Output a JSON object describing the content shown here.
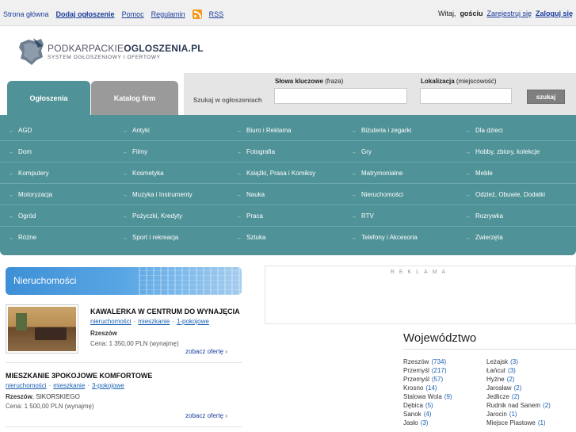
{
  "topbar": {
    "links": [
      "Strona główna",
      "Dodaj ogłoszenie",
      "Pomoc",
      "Regulamin",
      "RSS"
    ],
    "greeting": "Witaj,",
    "user": "gościu",
    "register": "Zarejestruj się",
    "login": "Zaloguj się"
  },
  "logo": {
    "name_part1": "PODKARPACKIE",
    "name_part2": "OGLOSZENIA.PL",
    "subtitle": "SYSTEM OGŁOSZENIOWY I OFERTOWY"
  },
  "tabs": {
    "ads": "Ogłoszenia",
    "catalog": "Katalog firm"
  },
  "search": {
    "label": "Szukaj w ogłoszeniach",
    "keywords_label": "Słowa kluczowe",
    "keywords_hint": "(fraza)",
    "location_label": "Lokalizacja",
    "location_hint": "(miejscowość)",
    "keywords_value": "",
    "location_value": "",
    "button": "szukaj"
  },
  "categories": [
    [
      "AGD",
      "Antyki",
      "Biuro i Reklama",
      "Biżuteria i zegarki",
      "Dla dzieci"
    ],
    [
      "Dom",
      "Filmy",
      "Fotografia",
      "Gry",
      "Hobby, zbiory, kolekcje"
    ],
    [
      "Komputery",
      "Kosmetyka",
      "Książki, Prasa i Komiksy",
      "Matrymonialne",
      "Meble"
    ],
    [
      "Motoryzacja",
      "Muzyka i Instrumenty",
      "Nauka",
      "Nieruchomości",
      "Odzież, Obuwie, Dodatki"
    ],
    [
      "Ogród",
      "Pożyczki, Kredyty",
      "Praca",
      "RTV",
      "Rozrywka"
    ],
    [
      "Różne",
      "Sport i rekreacja",
      "Sztuka",
      "Telefony i Akcesoria",
      "Zwierzęta"
    ]
  ],
  "section": {
    "title": "Nieruchomości"
  },
  "ads": [
    {
      "title": "KAWALERKA W CENTRUM DO WYNAJĘCIA",
      "tags": [
        "nieruchomości",
        "mieszkanie",
        "1-pokojowe"
      ],
      "city": "Rzeszów",
      "street": "",
      "price": "Cena: 1 350,00 PLN (wynajmę)",
      "more": "zobacz ofertę ›"
    },
    {
      "title": "MIESZKANIE 3POKOJOWE KOMFORTOWE",
      "tags": [
        "nieruchomości",
        "mieszkanie",
        "3-pokojowe"
      ],
      "city": "Rzeszów",
      "street": ", SIKORSKIEGO",
      "price": "Cena: 1 500,00 PLN (wynajmę)",
      "more": "zobacz ofertę ›"
    }
  ],
  "reklama": "REKLAMA",
  "wojewodztwo": {
    "title": "Województwo",
    "left": [
      {
        "name": "Rzeszów",
        "count": "(734)"
      },
      {
        "name": "Przemyśl",
        "count": "(217)"
      },
      {
        "name": "Przemyśl",
        "count": "(57)"
      },
      {
        "name": "Krosno",
        "count": "(14)"
      },
      {
        "name": "Stalowa Wola",
        "count": "(9)"
      },
      {
        "name": "Dębica",
        "count": "(5)"
      },
      {
        "name": "Sanok",
        "count": "(4)"
      },
      {
        "name": "Jasło",
        "count": "(3)"
      }
    ],
    "right": [
      {
        "name": "Leżajsk",
        "count": "(3)"
      },
      {
        "name": "Łańcut",
        "count": "(3)"
      },
      {
        "name": "Hyżne",
        "count": "(2)"
      },
      {
        "name": "Jarosław",
        "count": "(2)"
      },
      {
        "name": "Jedlicze",
        "count": "(2)"
      },
      {
        "name": "Rudnik nad Sanem",
        "count": "(2)"
      },
      {
        "name": "Jarocin",
        "count": "(1)"
      },
      {
        "name": "Miejsce Piastowe",
        "count": "(1)"
      }
    ]
  }
}
